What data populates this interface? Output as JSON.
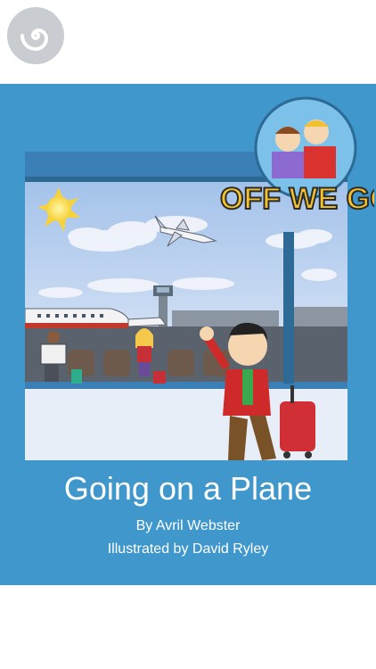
{
  "app": {
    "logo_icon": "spiral-logo-icon"
  },
  "cover": {
    "title": "Going on a Plane",
    "author": "By Avril Webster",
    "illustrator": "Illustrated by David Ryley",
    "series_badge": "OFF WE GO!",
    "background_color": "#3f97cc",
    "badge_color": "#f6c22a"
  }
}
